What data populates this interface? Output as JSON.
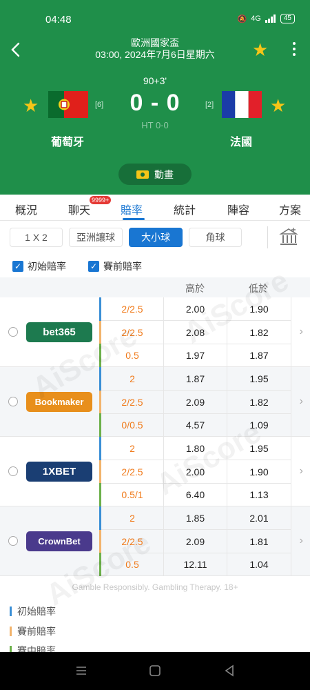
{
  "status_bar": {
    "time": "04:48",
    "signal": "4G",
    "battery": "45"
  },
  "match": {
    "competition": "歐洲國家盃",
    "datetime": "03:00, 2024年7月6日星期六",
    "minute": "90+3'",
    "score": "0 - 0",
    "half_time": "HT 0-0",
    "home": {
      "name": "葡萄牙",
      "rank": "[6]"
    },
    "away": {
      "name": "法國",
      "rank": "[2]"
    },
    "animation_label": "動畫"
  },
  "tabs": [
    {
      "label": "概況"
    },
    {
      "label": "聊天",
      "badge": "9999+"
    },
    {
      "label": "賠率"
    },
    {
      "label": "統計"
    },
    {
      "label": "陣容"
    },
    {
      "label": "方案"
    }
  ],
  "markets": [
    "1 X 2",
    "亞洲讓球",
    "大小球",
    "角球"
  ],
  "filters": [
    "初始賠率",
    "賽前賠率"
  ],
  "table_headers": {
    "over": "高於",
    "under": "低於"
  },
  "bookmakers": [
    {
      "name": "bet365",
      "color": "#1d7a4f",
      "rows": [
        {
          "line": "2/2.5",
          "over": "2.00",
          "under": "1.90"
        },
        {
          "line": "2/2.5",
          "over": "2.08",
          "under": "1.82"
        },
        {
          "line": "0.5",
          "over": "1.97",
          "under": "1.87"
        }
      ]
    },
    {
      "name": "Bookmaker",
      "color": "#e88f1c",
      "rows": [
        {
          "line": "2",
          "over": "1.87",
          "under": "1.95"
        },
        {
          "line": "2/2.5",
          "over": "2.09",
          "under": "1.82"
        },
        {
          "line": "0/0.5",
          "over": "4.57",
          "under": "1.09"
        }
      ]
    },
    {
      "name": "1XBET",
      "color": "#1a3e73",
      "rows": [
        {
          "line": "2",
          "over": "1.80",
          "under": "1.95"
        },
        {
          "line": "2/2.5",
          "over": "2.00",
          "under": "1.90"
        },
        {
          "line": "0.5/1",
          "over": "6.40",
          "under": "1.13"
        }
      ]
    },
    {
      "name": "CrownBet",
      "color": "#4a3a8c",
      "rows": [
        {
          "line": "2",
          "over": "1.85",
          "under": "2.01"
        },
        {
          "line": "2/2.5",
          "over": "2.09",
          "under": "1.81"
        },
        {
          "line": "0.5",
          "over": "12.11",
          "under": "1.04"
        }
      ]
    }
  ],
  "row_bar_colors": [
    "#3a8fd6",
    "#f2b36b",
    "#6cb04a"
  ],
  "disclaimer": "Gamble Responsibly. Gambling Therapy. 18+",
  "legend": [
    {
      "label": "初始賠率",
      "color": "#3a8fd6"
    },
    {
      "label": "賽前賠率",
      "color": "#f2b36b"
    },
    {
      "label": "賽中賠率",
      "color": "#6cb04a"
    }
  ],
  "watermark_text": "AiScore"
}
